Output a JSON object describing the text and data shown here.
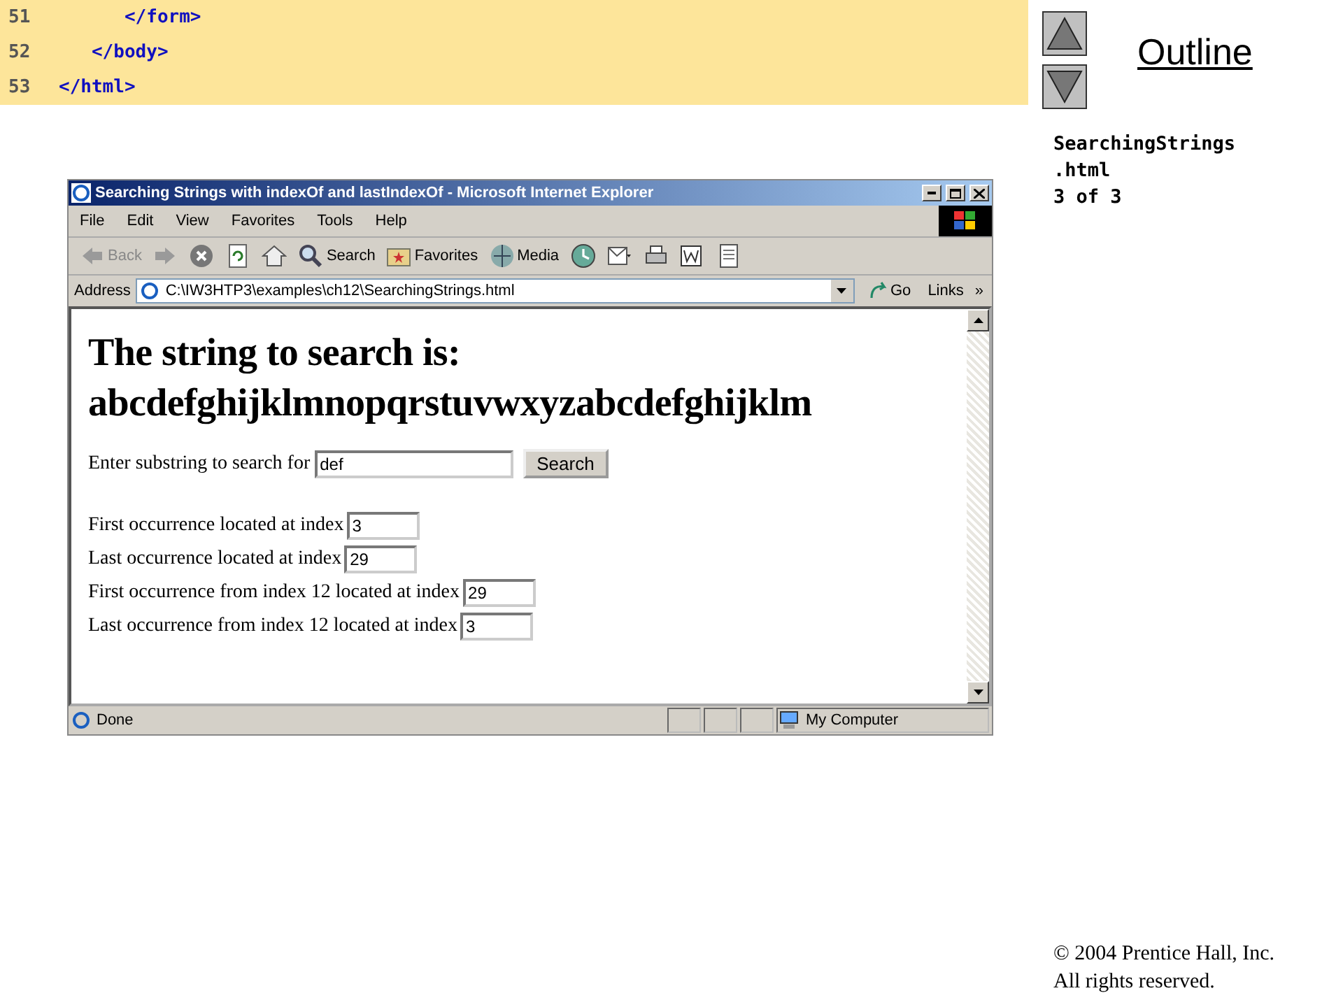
{
  "code_panel": {
    "lines": [
      {
        "number": "51",
        "code": "      </form>"
      },
      {
        "number": "52",
        "code": "   </body>"
      },
      {
        "number": "53",
        "code": "</html>"
      }
    ]
  },
  "browser": {
    "window": {
      "title": "Searching Strings with indexOf and lastIndexOf - Microsoft Internet Explorer"
    },
    "menu": [
      "File",
      "Edit",
      "View",
      "Favorites",
      "Tools",
      "Help"
    ],
    "toolbar": [
      {
        "kind": "back",
        "label": "Back",
        "disabled": true
      },
      {
        "kind": "forward",
        "disabled": true
      },
      {
        "kind": "stop",
        "disabled": false
      },
      {
        "kind": "refresh",
        "disabled": false
      },
      {
        "kind": "home",
        "disabled": false
      },
      {
        "kind": "search",
        "label": "Search",
        "disabled": false
      },
      {
        "kind": "favorites",
        "label": "Favorites",
        "disabled": false
      },
      {
        "kind": "media",
        "label": "Media",
        "disabled": false
      },
      {
        "kind": "history",
        "disabled": false
      },
      {
        "kind": "mail",
        "disabled": false
      },
      {
        "kind": "print",
        "disabled": false
      },
      {
        "kind": "edit",
        "disabled": false
      },
      {
        "kind": "discuss",
        "disabled": false
      }
    ],
    "address": {
      "label": "Address",
      "value": "C:\\IW3HTP3\\examples\\ch12\\SearchingStrings.html",
      "go": "Go",
      "links": "Links",
      "more": "»"
    },
    "page": {
      "heading": [
        "The string to search is:",
        "abcdefghijklmnopqrstuvwxyzabcdefghijklm"
      ],
      "search": {
        "label": "Enter substring to search for",
        "value": "def",
        "button": "Search"
      },
      "results": [
        {
          "label": "First occurrence located at index",
          "value": "3"
        },
        {
          "label": "Last occurrence located at index",
          "value": "29"
        },
        {
          "label": "First occurrence from index 12 located at index",
          "value": "29"
        },
        {
          "label": "Last occurrence from index 12 located at index",
          "value": "3"
        }
      ]
    },
    "status_bar": {
      "text": "Done",
      "zone": "My Computer"
    }
  },
  "sidebar": {
    "link": "Outline",
    "file": [
      "SearchingStrings",
      ".html",
      "3 of 3"
    ]
  },
  "footer": [
    "© 2004 Prentice Hall, Inc.",
    "All rights reserved."
  ]
}
